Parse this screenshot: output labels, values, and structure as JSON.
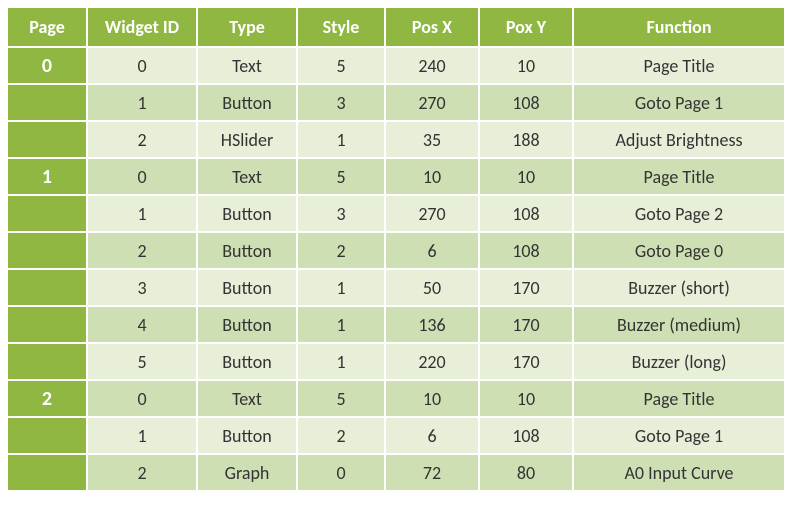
{
  "chart_data": {
    "type": "table",
    "columns": [
      "Page",
      "Widget ID",
      "Type",
      "Style",
      "Pos X",
      "Pox Y",
      "Function"
    ],
    "rows": [
      {
        "page": "0",
        "widget_id": "0",
        "type": "Text",
        "style": "5",
        "pos_x": "240",
        "pos_y": "10",
        "function": "Page Title"
      },
      {
        "page": "",
        "widget_id": "1",
        "type": "Button",
        "style": "3",
        "pos_x": "270",
        "pos_y": "108",
        "function": "Goto Page 1"
      },
      {
        "page": "",
        "widget_id": "2",
        "type": "HSlider",
        "style": "1",
        "pos_x": "35",
        "pos_y": "188",
        "function": "Adjust Brightness"
      },
      {
        "page": "1",
        "widget_id": "0",
        "type": "Text",
        "style": "5",
        "pos_x": "10",
        "pos_y": "10",
        "function": "Page Title"
      },
      {
        "page": "",
        "widget_id": "1",
        "type": "Button",
        "style": "3",
        "pos_x": "270",
        "pos_y": "108",
        "function": "Goto Page 2"
      },
      {
        "page": "",
        "widget_id": "2",
        "type": "Button",
        "style": "2",
        "pos_x": "6",
        "pos_y": "108",
        "function": "Goto Page 0"
      },
      {
        "page": "",
        "widget_id": "3",
        "type": "Button",
        "style": "1",
        "pos_x": "50",
        "pos_y": "170",
        "function": "Buzzer (short)"
      },
      {
        "page": "",
        "widget_id": "4",
        "type": "Button",
        "style": "1",
        "pos_x": "136",
        "pos_y": "170",
        "function": "Buzzer (medium)"
      },
      {
        "page": "",
        "widget_id": "5",
        "type": "Button",
        "style": "1",
        "pos_x": "220",
        "pos_y": "170",
        "function": "Buzzer (long)"
      },
      {
        "page": "2",
        "widget_id": "0",
        "type": "Text",
        "style": "5",
        "pos_x": "10",
        "pos_y": "10",
        "function": "Page Title"
      },
      {
        "page": "",
        "widget_id": "1",
        "type": "Button",
        "style": "2",
        "pos_x": "6",
        "pos_y": "108",
        "function": "Goto Page 1"
      },
      {
        "page": "",
        "widget_id": "2",
        "type": "Graph",
        "style": "0",
        "pos_x": "72",
        "pos_y": "80",
        "function": "A0 Input Curve"
      }
    ]
  }
}
